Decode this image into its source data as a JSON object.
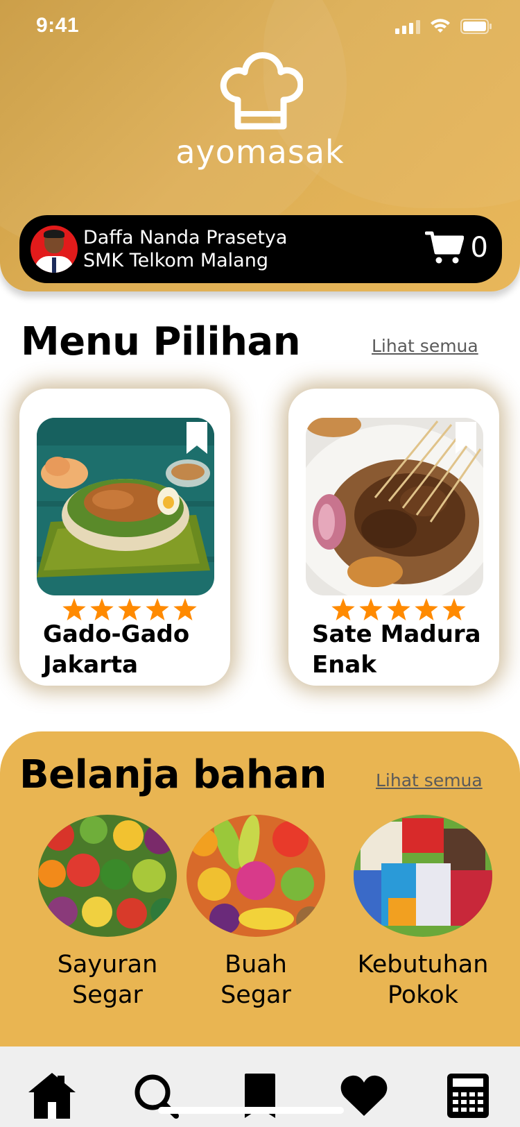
{
  "status_bar": {
    "time": "9:41"
  },
  "app": {
    "name": "ayomasak"
  },
  "profile": {
    "name": "Daffa Nanda Prasetya",
    "school": "SMK Telkom Malang",
    "cart_count": "0"
  },
  "menu_section": {
    "title": "Menu Pilihan",
    "see_all": "Lihat semua",
    "items": [
      {
        "title_line1": "Gado-Gado",
        "title_line2": "Jakarta",
        "rating": 5
      },
      {
        "title_line1": "Sate Madura",
        "title_line2": "Enak",
        "rating": 5
      }
    ]
  },
  "shop_section": {
    "title": "Belanja bahan",
    "see_all": "Lihat semua",
    "items": [
      {
        "line1": "Sayuran",
        "line2": "Segar"
      },
      {
        "line1": "Buah",
        "line2": "Segar"
      },
      {
        "line1": "Kebutuhan",
        "line2": "Pokok"
      }
    ]
  },
  "bottom_nav": {
    "items": [
      "home-icon",
      "search-icon",
      "bookmark-icon",
      "heart-icon",
      "calculator-icon"
    ]
  },
  "colors": {
    "header_gold": "#ddae55",
    "shop_gold": "#e9b552",
    "star_orange": "#ff8a00",
    "profile_bar": "#000000"
  }
}
